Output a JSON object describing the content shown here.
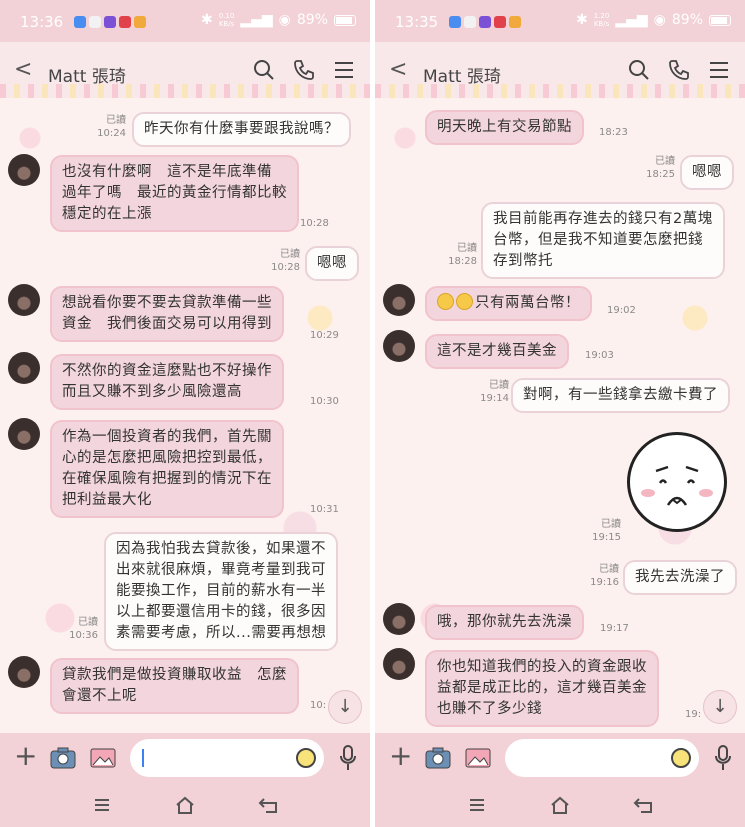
{
  "colors": {
    "bubble_in": "#f3d6dd",
    "bubble_out": "#fdfcfb",
    "bar": "#f2d1d7"
  },
  "read_label": "已讀",
  "screens": [
    {
      "status": {
        "time": "13:36",
        "speed_top": "0.10",
        "speed_bottom": "KB/s",
        "battery": "89%"
      },
      "contact": "Matt 張琦",
      "messages": [
        {
          "dir": "out",
          "text": "昨天你有什麼事要跟我說嗎？",
          "read": true,
          "time": "10:24"
        },
        {
          "dir": "in",
          "text": "也沒有什麼啊　這不是年底準備\n過年了嗎　最近的黃金行情都比較\n穩定的在上漲",
          "time": "10:28"
        },
        {
          "dir": "out",
          "text": "嗯嗯",
          "read": true,
          "time": "10:28"
        },
        {
          "dir": "in",
          "text": "想說看你要不要去貸款準備一些\n資金　我們後面交易可以用得到",
          "time": "10:29"
        },
        {
          "dir": "in",
          "text": "不然你的資金這麼點也不好操作\n而且又賺不到多少風險還高",
          "time": "10:30"
        },
        {
          "dir": "in",
          "text": "作為一個投資者的我們，首先關\n心的是怎麼把風險把控到最低，\n在確保風險有把握到的情況下在\n把利益最大化",
          "time": "10:31"
        },
        {
          "dir": "out",
          "text": "因為我怕我去貸款後，如果還不\n出來就很麻煩，畢竟考量到我可\n能要換工作，目前的薪水有一半\n以上都要還信用卡的錢，很多因\n素需要考慮，所以...需要再想想",
          "read": true,
          "time": "10:36"
        },
        {
          "dir": "in",
          "text": "貸款我們是做投資賺取收益　怎麼\n會還不上呢",
          "time": "10:"
        }
      ]
    },
    {
      "status": {
        "time": "13:35",
        "speed_top": "1.20",
        "speed_bottom": "KB/s",
        "battery": "89%"
      },
      "contact": "Matt 張琦",
      "messages": [
        {
          "dir": "in",
          "text": "明天晚上有交易節點",
          "time": "18:23"
        },
        {
          "dir": "out",
          "text": "嗯嗯",
          "read": true,
          "time": "18:25"
        },
        {
          "dir": "out",
          "text": "我目前能再存進去的錢只有2萬塊\n台幣，但是我不知道要怎麼把錢\n存到幣托",
          "read": true,
          "time": "18:28"
        },
        {
          "dir": "in",
          "text": "只有兩萬台幣！",
          "emoji": "rofl-emoji",
          "time": "19:02"
        },
        {
          "dir": "in",
          "text": "這不是才幾百美金",
          "time": "19:03"
        },
        {
          "dir": "out",
          "text": "對啊，有一些錢拿去繳卡費了",
          "read": true,
          "time": "19:14"
        },
        {
          "dir": "out",
          "sticker": "sad-face-sticker",
          "read": true,
          "time": "19:15"
        },
        {
          "dir": "out",
          "text": "我先去洗澡了",
          "read": true,
          "time": "19:16"
        },
        {
          "dir": "in",
          "text": "哦，那你就先去洗澡",
          "time": "19:17"
        },
        {
          "dir": "in",
          "text": "你也知道我們的投入的資金跟收\n益都是成正比的，這才幾百美金\n也賺不了多少錢",
          "time": "19:"
        }
      ]
    }
  ]
}
